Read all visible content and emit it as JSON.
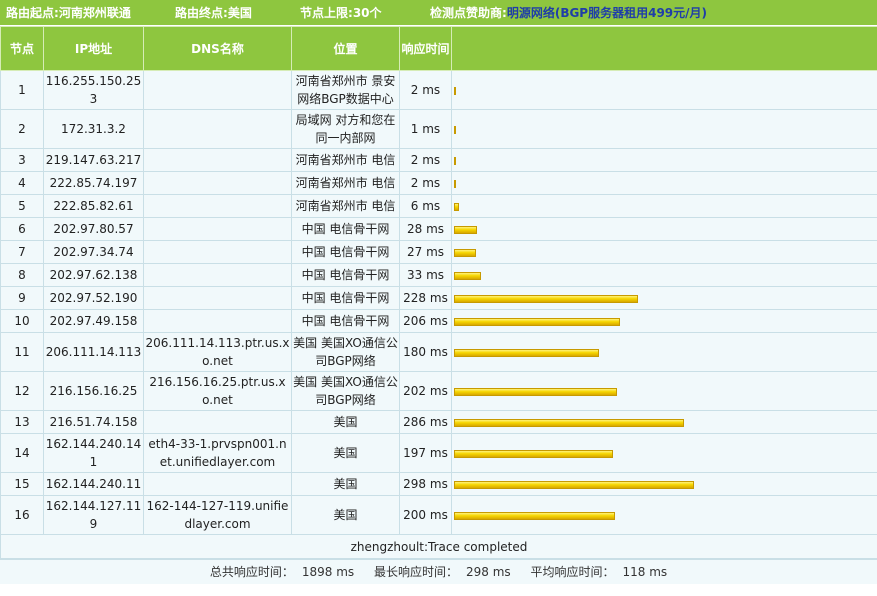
{
  "topbar": {
    "from_label": "路由起点:",
    "from_value": "河南郑州联通",
    "to_label": "路由终点:",
    "to_value": "美国",
    "hops_label": "节点上限:",
    "hops_value": "30个",
    "sponsor_label": "检测点赞助商:",
    "sponsor_name": "明源网络",
    "sponsor_ad": "(BGP服务器租用499元/月)"
  },
  "table": {
    "headers": [
      "节点",
      "IP地址",
      "DNS名称",
      "位置",
      "响应时间",
      ""
    ],
    "rows": [
      {
        "hop": "1",
        "ip": "116.255.150.253",
        "dns": "",
        "location": "河南省郑州市 景安网络BGP数据中心",
        "time": "2 ms",
        "ms": 2
      },
      {
        "hop": "2",
        "ip": "172.31.3.2",
        "dns": "",
        "location": "局域网 对方和您在同一内部网",
        "time": "1 ms",
        "ms": 1
      },
      {
        "hop": "3",
        "ip": "219.147.63.217",
        "dns": "",
        "location": "河南省郑州市 电信",
        "time": "2 ms",
        "ms": 2
      },
      {
        "hop": "4",
        "ip": "222.85.74.197",
        "dns": "",
        "location": "河南省郑州市 电信",
        "time": "2 ms",
        "ms": 2
      },
      {
        "hop": "5",
        "ip": "222.85.82.61",
        "dns": "",
        "location": "河南省郑州市 电信",
        "time": "6 ms",
        "ms": 6
      },
      {
        "hop": "6",
        "ip": "202.97.80.57",
        "dns": "",
        "location": "中国 电信骨干网",
        "time": "28 ms",
        "ms": 28
      },
      {
        "hop": "7",
        "ip": "202.97.34.74",
        "dns": "",
        "location": "中国 电信骨干网",
        "time": "27 ms",
        "ms": 27
      },
      {
        "hop": "8",
        "ip": "202.97.62.138",
        "dns": "",
        "location": "中国 电信骨干网",
        "time": "33 ms",
        "ms": 33
      },
      {
        "hop": "9",
        "ip": "202.97.52.190",
        "dns": "",
        "location": "中国 电信骨干网",
        "time": "228 ms",
        "ms": 228
      },
      {
        "hop": "10",
        "ip": "202.97.49.158",
        "dns": "",
        "location": "中国 电信骨干网",
        "time": "206 ms",
        "ms": 206
      },
      {
        "hop": "11",
        "ip": "206.111.14.113",
        "dns": "206.111.14.113.ptr.us.xo.net",
        "location": "美国 美国XO通信公司BGP网络",
        "time": "180 ms",
        "ms": 180
      },
      {
        "hop": "12",
        "ip": "216.156.16.25",
        "dns": "216.156.16.25.ptr.us.xo.net",
        "location": "美国 美国XO通信公司BGP网络",
        "time": "202 ms",
        "ms": 202
      },
      {
        "hop": "13",
        "ip": "216.51.74.158",
        "dns": "",
        "location": "美国",
        "time": "286 ms",
        "ms": 286
      },
      {
        "hop": "14",
        "ip": "162.144.240.141",
        "dns": "eth4-33-1.prvspn001.net.unifiedlayer.com",
        "location": "美国",
        "time": "197 ms",
        "ms": 197
      },
      {
        "hop": "15",
        "ip": "162.144.240.11",
        "dns": "",
        "location": "美国",
        "time": "298 ms",
        "ms": 298
      },
      {
        "hop": "16",
        "ip": "162.144.127.119",
        "dns": "162-144-127-119.unifiedlayer.com",
        "location": "美国",
        "time": "200 ms",
        "ms": 200
      }
    ],
    "status": "zhengzhoult:Trace completed"
  },
  "summary": {
    "total_label": "总共响应时间：",
    "total_value": "1898 ms",
    "max_label": "最长响应时间：",
    "max_value": "298 ms",
    "avg_label": "平均响应时间：",
    "avg_value": "118 ms"
  },
  "colors": {
    "header_green": "#8ec63f",
    "row_bg": "#f1f9fb",
    "bar_yellow": "#f6d600",
    "link_blue": "#1f3ea8"
  }
}
